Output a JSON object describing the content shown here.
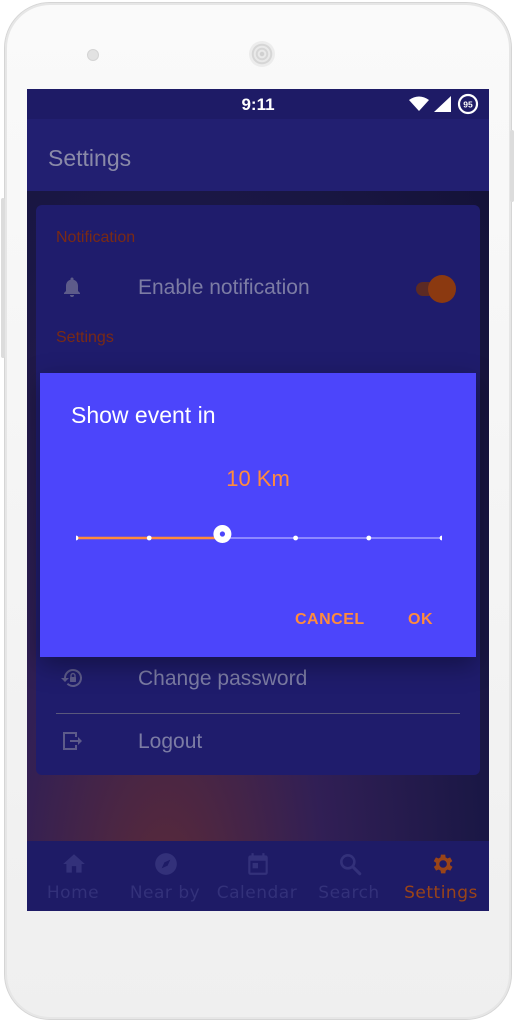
{
  "status_bar": {
    "time": "9:11",
    "battery_level": "95",
    "icons": [
      "wifi-icon",
      "signal-icon",
      "battery-icon"
    ]
  },
  "app_bar": {
    "title": "Settings"
  },
  "settings": {
    "notification_section": "Notification",
    "enable_notification_label": "Enable notification",
    "enable_notification_on": true,
    "settings_section": "Settings",
    "change_password_label": "Change password",
    "logout_label": "Logout"
  },
  "dialog": {
    "title": "Show event in",
    "value": "10 Km",
    "slider_steps": 6,
    "slider_selected_index": 2,
    "cancel_label": "CANCEL",
    "ok_label": "OK"
  },
  "bottom_nav": {
    "items": [
      {
        "label": "Home",
        "icon": "home-icon"
      },
      {
        "label": "Near by",
        "icon": "compass-icon"
      },
      {
        "label": "Calendar",
        "icon": "calendar-icon"
      },
      {
        "label": "Search",
        "icon": "search-icon"
      },
      {
        "label": "Settings",
        "icon": "gear-icon"
      }
    ],
    "active_index": 4
  },
  "colors": {
    "primary": "#1f1c6a",
    "dialog": "#4c45fb",
    "accent": "#ff8b3d",
    "slider_active": "#ff8b3d",
    "slider_inactive": "#8d88ff"
  }
}
